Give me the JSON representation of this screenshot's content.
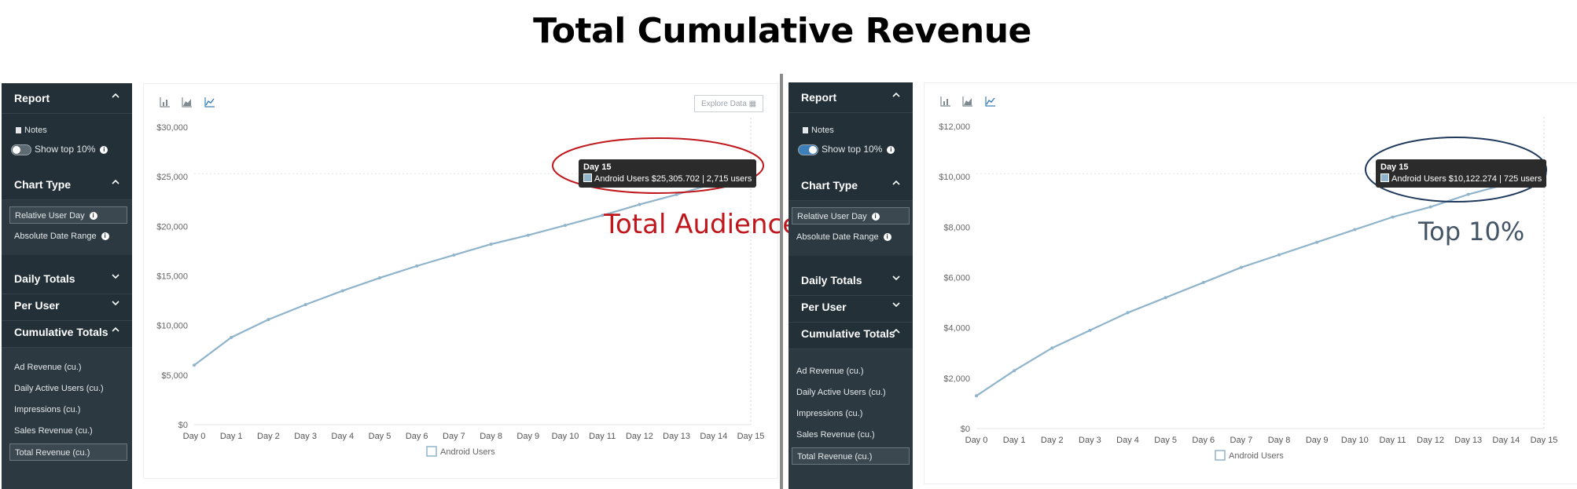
{
  "page": {
    "title": "Total Cumulative Revenue"
  },
  "colors": {
    "sidebar_bg": "#233038",
    "line": "#8fb4cb",
    "annot_left": "#c0171c",
    "annot_right": "#445566"
  },
  "left": {
    "sidebar": {
      "report_header": "Report",
      "notes_label": "Notes",
      "show_top_label": "Show top 10%",
      "show_top_on": false,
      "chart_type_header": "Chart Type",
      "chart_type_items": [
        "Relative User Day",
        "Absolute Date Range"
      ],
      "chart_type_selected": 0,
      "daily_totals_header": "Daily Totals",
      "per_user_header": "Per User",
      "cumulative_header": "Cumulative Totals",
      "cumulative_items": [
        "Ad Revenue (cu.)",
        "Daily Active Users (cu.)",
        "Impressions (cu.)",
        "Sales Revenue (cu.)",
        "Total Revenue (cu.)"
      ],
      "cumulative_selected": 4
    },
    "explore_label": "Explore Data",
    "tooltip": {
      "title": "Day 15",
      "series": "Android Users",
      "value": "$25,305.702 | 2,715 users"
    },
    "annotation": "Total Audience"
  },
  "right": {
    "sidebar": {
      "report_header": "Report",
      "notes_label": "Notes",
      "show_top_label": "Show top 10%",
      "show_top_on": true,
      "chart_type_header": "Chart Type",
      "chart_type_items": [
        "Relative User Day",
        "Absolute Date Range"
      ],
      "chart_type_selected": 0,
      "daily_totals_header": "Daily Totals",
      "per_user_header": "Per User",
      "cumulative_header": "Cumulative Totals",
      "cumulative_items": [
        "Ad Revenue (cu.)",
        "Daily Active Users (cu.)",
        "Impressions (cu.)",
        "Sales Revenue (cu.)",
        "Total Revenue (cu.)"
      ],
      "cumulative_selected": 4
    },
    "tooltip": {
      "title": "Day 15",
      "series": "Android Users",
      "value": "$10,122.274 | 725 users"
    },
    "annotation": "Top 10%"
  },
  "chart_data": [
    {
      "type": "line",
      "x": [
        "Day 0",
        "Day 1",
        "Day 2",
        "Day 3",
        "Day 4",
        "Day 5",
        "Day 6",
        "Day 7",
        "Day 8",
        "Day 9",
        "Day 10",
        "Day 11",
        "Day 12",
        "Day 13",
        "Day 14",
        "Day 15"
      ],
      "series": [
        {
          "name": "Android Users",
          "values": [
            6000,
            8800,
            10600,
            12100,
            13500,
            14800,
            16000,
            17100,
            18200,
            19100,
            20100,
            21100,
            22200,
            23200,
            24300,
            25305.702
          ]
        }
      ],
      "y_ticks": [
        "$0",
        "$5,000",
        "$10,000",
        "$15,000",
        "$20,000",
        "$25,000",
        "$30,000"
      ],
      "ylim": [
        0,
        30000
      ],
      "legend": "bottom",
      "grid": false
    },
    {
      "type": "line",
      "x": [
        "Day 0",
        "Day 1",
        "Day 2",
        "Day 3",
        "Day 4",
        "Day 5",
        "Day 6",
        "Day 7",
        "Day 8",
        "Day 9",
        "Day 10",
        "Day 11",
        "Day 12",
        "Day 13",
        "Day 14",
        "Day 15"
      ],
      "series": [
        {
          "name": "Android Users",
          "values": [
            1300,
            2300,
            3200,
            3900,
            4600,
            5200,
            5800,
            6400,
            6900,
            7400,
            7900,
            8400,
            8800,
            9300,
            9700,
            10122.274
          ]
        }
      ],
      "y_ticks": [
        "$0",
        "$2,000",
        "$4,000",
        "$6,000",
        "$8,000",
        "$10,000",
        "$12,000"
      ],
      "ylim": [
        0,
        12000
      ],
      "legend": "bottom",
      "grid": false
    }
  ]
}
